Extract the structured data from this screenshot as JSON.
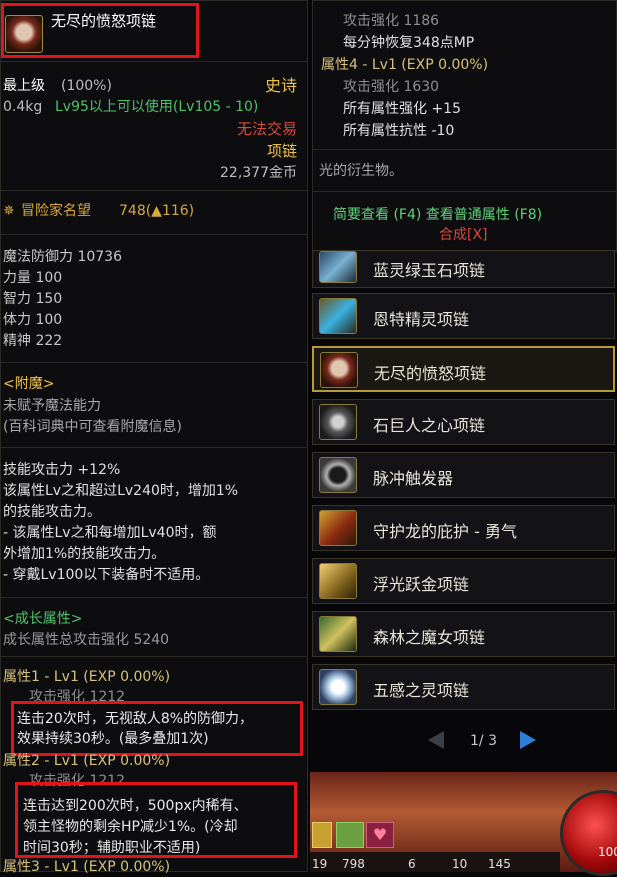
{
  "left": {
    "item_name": "无尽的愤怒项链",
    "grade": "最上级",
    "grade_pct": "(100%)",
    "rarity": "史诗",
    "weight": "0.4kg",
    "level_req": "Lv95以上可以使用(Lv105 - 10)",
    "trade": "无法交易",
    "slot": "项链",
    "price": "22,377金币",
    "fame_label": "冒险家名望",
    "fame_value": "748(▲116)",
    "stats": [
      "魔法防御力 10736",
      "力量 100",
      "智力 150",
      "体力 100",
      "精神 222"
    ],
    "enchant_header": "<附魔>",
    "enchant_lines": [
      "未赋予魔法能力",
      "(百科词典中可查看附魔信息)"
    ],
    "skill_lines": [
      "技能攻击力 +12%",
      "该属性Lv之和超过Lv240时，增加1%",
      "的技能攻击力。",
      "- 该属性Lv之和每增加Lv40时，额",
      "外增加1%的技能攻击力。",
      "- 穿戴Lv100以下装备时不适用。"
    ],
    "growth_header": "<成长属性>",
    "growth_total": "成长属性总攻击强化 5240",
    "attr1": "属性1 - Lv1 (EXP 0.00%)",
    "attr1_atk": "攻击强化 1212",
    "attr1_desc": [
      "连击20次时，无视敌人8%的防御力，",
      "效果持续30秒。(最多叠加1次)"
    ],
    "attr2": "属性2 - Lv1 (EXP 0.00%)",
    "attr2_atk": "攻击强化 1212",
    "attr2_desc": [
      "连击达到200次时，500px内稀有、",
      "领主怪物的剩余HP减少1%。(冷却",
      "时间30秒；辅助职业不适用)"
    ],
    "attr3": "属性3 - Lv1 (EXP 0.00%)"
  },
  "right": {
    "top_lines": [
      "攻击强化 1186",
      "每分钟恢复348点MP",
      "属性4 - Lv1 (EXP 0.00%)",
      "攻击强化 1630",
      "所有属性强化 +15",
      "所有属性抗性 -10"
    ],
    "desc": "光的衍生物。",
    "footer_link": "简要查看 (F4) 查看普通属性 (F8)",
    "synth": "合成[X]",
    "items": [
      {
        "name": "蓝灵绿玉石项链",
        "icon": "crystal-necklace-icon"
      },
      {
        "name": "恩特精灵项链",
        "icon": "spirit-necklace-icon"
      },
      {
        "name": "无尽的愤怒项链",
        "icon": "rage-necklace-icon"
      },
      {
        "name": "石巨人之心项链",
        "icon": "golem-necklace-icon"
      },
      {
        "name": "脉冲触发器",
        "icon": "pulse-trigger-icon"
      },
      {
        "name": "守护龙的庇护 - 勇气",
        "icon": "dragon-necklace-icon"
      },
      {
        "name": "浮光跃金项链",
        "icon": "gold-necklace-icon"
      },
      {
        "name": "森林之魔女项链",
        "icon": "witch-necklace-icon"
      },
      {
        "name": "五感之灵项链",
        "icon": "senses-necklace-icon"
      }
    ],
    "page": "1/ 3",
    "bottom_nums": [
      "19",
      "798",
      "6",
      "10",
      "145"
    ],
    "corner_num": "100"
  }
}
